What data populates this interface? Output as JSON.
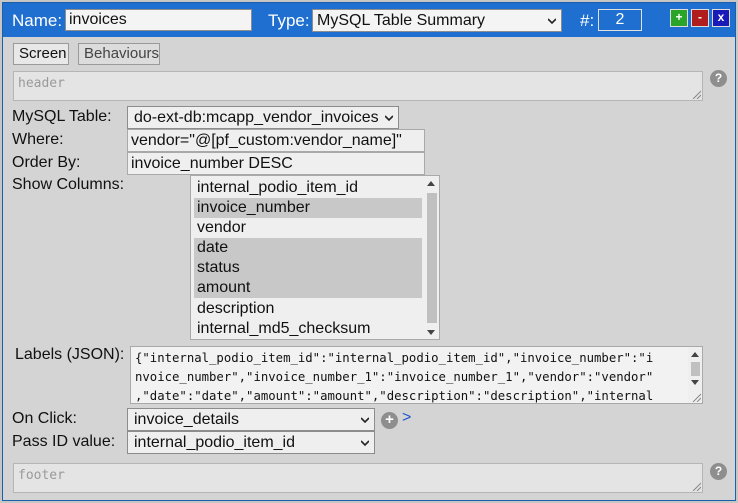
{
  "title_bar": {
    "name_label": "Name:",
    "name_value": "invoices",
    "type_label": "Type:",
    "type_value": "MySQL Table Summary",
    "number_label": "#:",
    "number_value": "2",
    "add_label": "+",
    "remove_label": "-",
    "close_label": "x",
    "colors": {
      "bar": "#1f6fd0",
      "add": "#2aa52a",
      "remove": "#b01d1d",
      "close": "#1a1ab8"
    }
  },
  "tabs": [
    {
      "label": "Screen"
    },
    {
      "label": "Behaviours"
    }
  ],
  "header_placeholder": "header",
  "footer_placeholder": "footer",
  "help_glyph": "?",
  "form": {
    "mysql_table_label": "MySQL Table:",
    "mysql_table_value": "do-ext-db:mcapp_vendor_invoices",
    "where_label": "Where:",
    "where_value": "vendor=\"@[pf_custom:vendor_name]\"",
    "order_by_label": "Order By:",
    "order_by_value": "invoice_number DESC",
    "show_columns_label": "Show Columns:",
    "columns": [
      {
        "name": "internal_podio_item_id",
        "selected": false
      },
      {
        "name": "invoice_number",
        "selected": true
      },
      {
        "name": "vendor",
        "selected": false
      },
      {
        "name": "date",
        "selected": true
      },
      {
        "name": "status",
        "selected": true
      },
      {
        "name": "amount",
        "selected": true
      },
      {
        "name": "description",
        "selected": false
      },
      {
        "name": "internal_md5_checksum",
        "selected": false
      }
    ],
    "labels_json_label": "Labels (JSON):",
    "labels_json_lines": [
      "{\"internal_podio_item_id\":\"internal_podio_item_id\",\"invoice_number\":\"i",
      "nvoice_number\",\"invoice_number_1\":\"invoice_number_1\",\"vendor\":\"vendor\"",
      ",\"date\":\"date\",\"amount\":\"amount\",\"description\":\"description\",\"internal"
    ],
    "on_click_label": "On Click:",
    "on_click_value": "invoice_details",
    "on_click_add_glyph": "+",
    "on_click_link_glyph": ">",
    "pass_id_label": "Pass ID value:",
    "pass_id_value": "internal_podio_item_id"
  }
}
